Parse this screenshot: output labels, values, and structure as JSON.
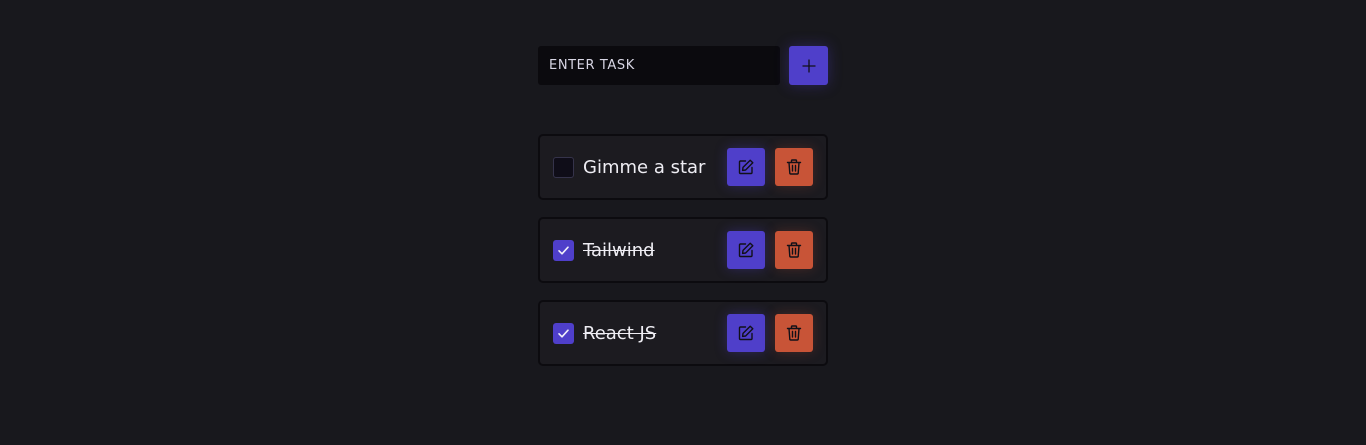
{
  "input": {
    "placeholder": "ENTER TASK",
    "value": ""
  },
  "add_button": {
    "icon": "plus-icon"
  },
  "tasks": [
    {
      "text": "Gimme a star",
      "completed": false
    },
    {
      "text": "Tailwind",
      "completed": true
    },
    {
      "text": "React JS",
      "completed": true
    }
  ],
  "colors": {
    "background": "#18181d",
    "accent": "#4f3fca",
    "danger": "#c85437",
    "input_bg": "#0b0a0e",
    "item_bg": "#1c1b20"
  }
}
